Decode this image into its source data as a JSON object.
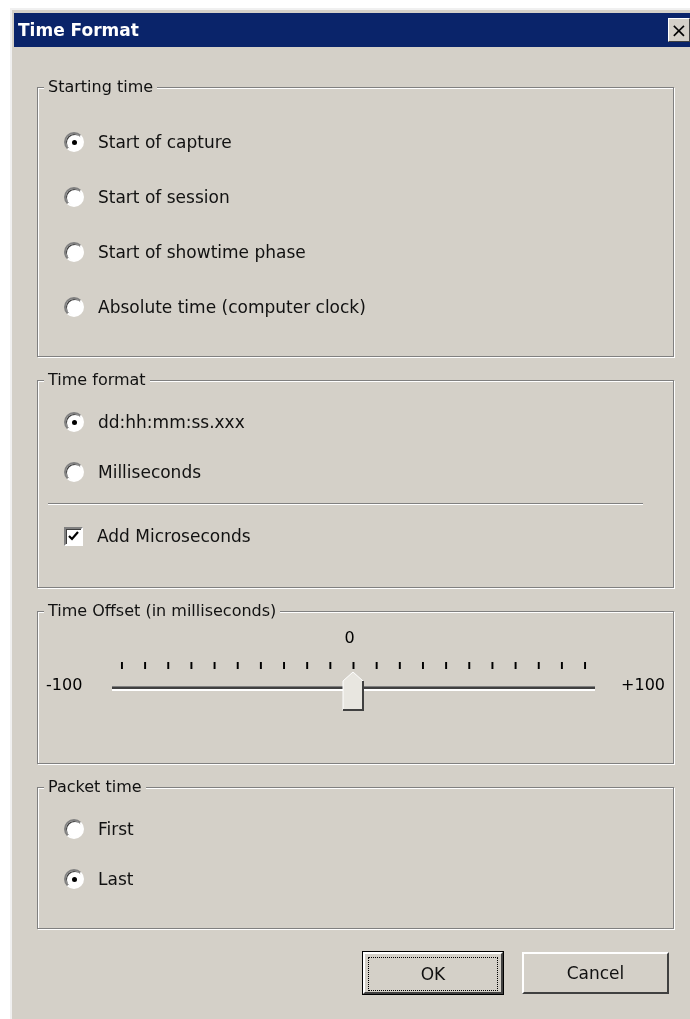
{
  "window": {
    "title": "Time Format",
    "close": "×"
  },
  "groups": [
    {
      "title": "Starting time",
      "kind": "options",
      "items": [
        {
          "kind": "radio",
          "label": "Start of capture",
          "selected": true
        },
        {
          "kind": "radio",
          "label": "Start of session",
          "selected": false
        },
        {
          "kind": "radio",
          "label": "Start of showtime phase",
          "selected": false
        },
        {
          "kind": "radio",
          "label": "Absolute time (computer clock)",
          "selected": false
        }
      ]
    },
    {
      "title": "Time format",
      "kind": "options",
      "items": [
        {
          "kind": "radio",
          "label": "dd:hh:mm:ss.xxx",
          "selected": true
        },
        {
          "kind": "radio",
          "label": "Milliseconds",
          "selected": false
        },
        {
          "kind": "separator"
        },
        {
          "kind": "checkbox",
          "label": "Add Microseconds",
          "checked": true
        }
      ]
    },
    {
      "title": "Time Offset (in milliseconds)",
      "kind": "slider",
      "value": "0",
      "min": "-100",
      "max": "+100",
      "level": 0.5
    },
    {
      "title": "Packet time",
      "kind": "options",
      "items": [
        {
          "kind": "radio",
          "label": "First",
          "selected": false
        },
        {
          "kind": "radio",
          "label": "Last",
          "selected": true
        }
      ]
    }
  ],
  "buttons": [
    {
      "label": "OK",
      "default": true
    },
    {
      "label": "Cancel",
      "default": false
    }
  ]
}
